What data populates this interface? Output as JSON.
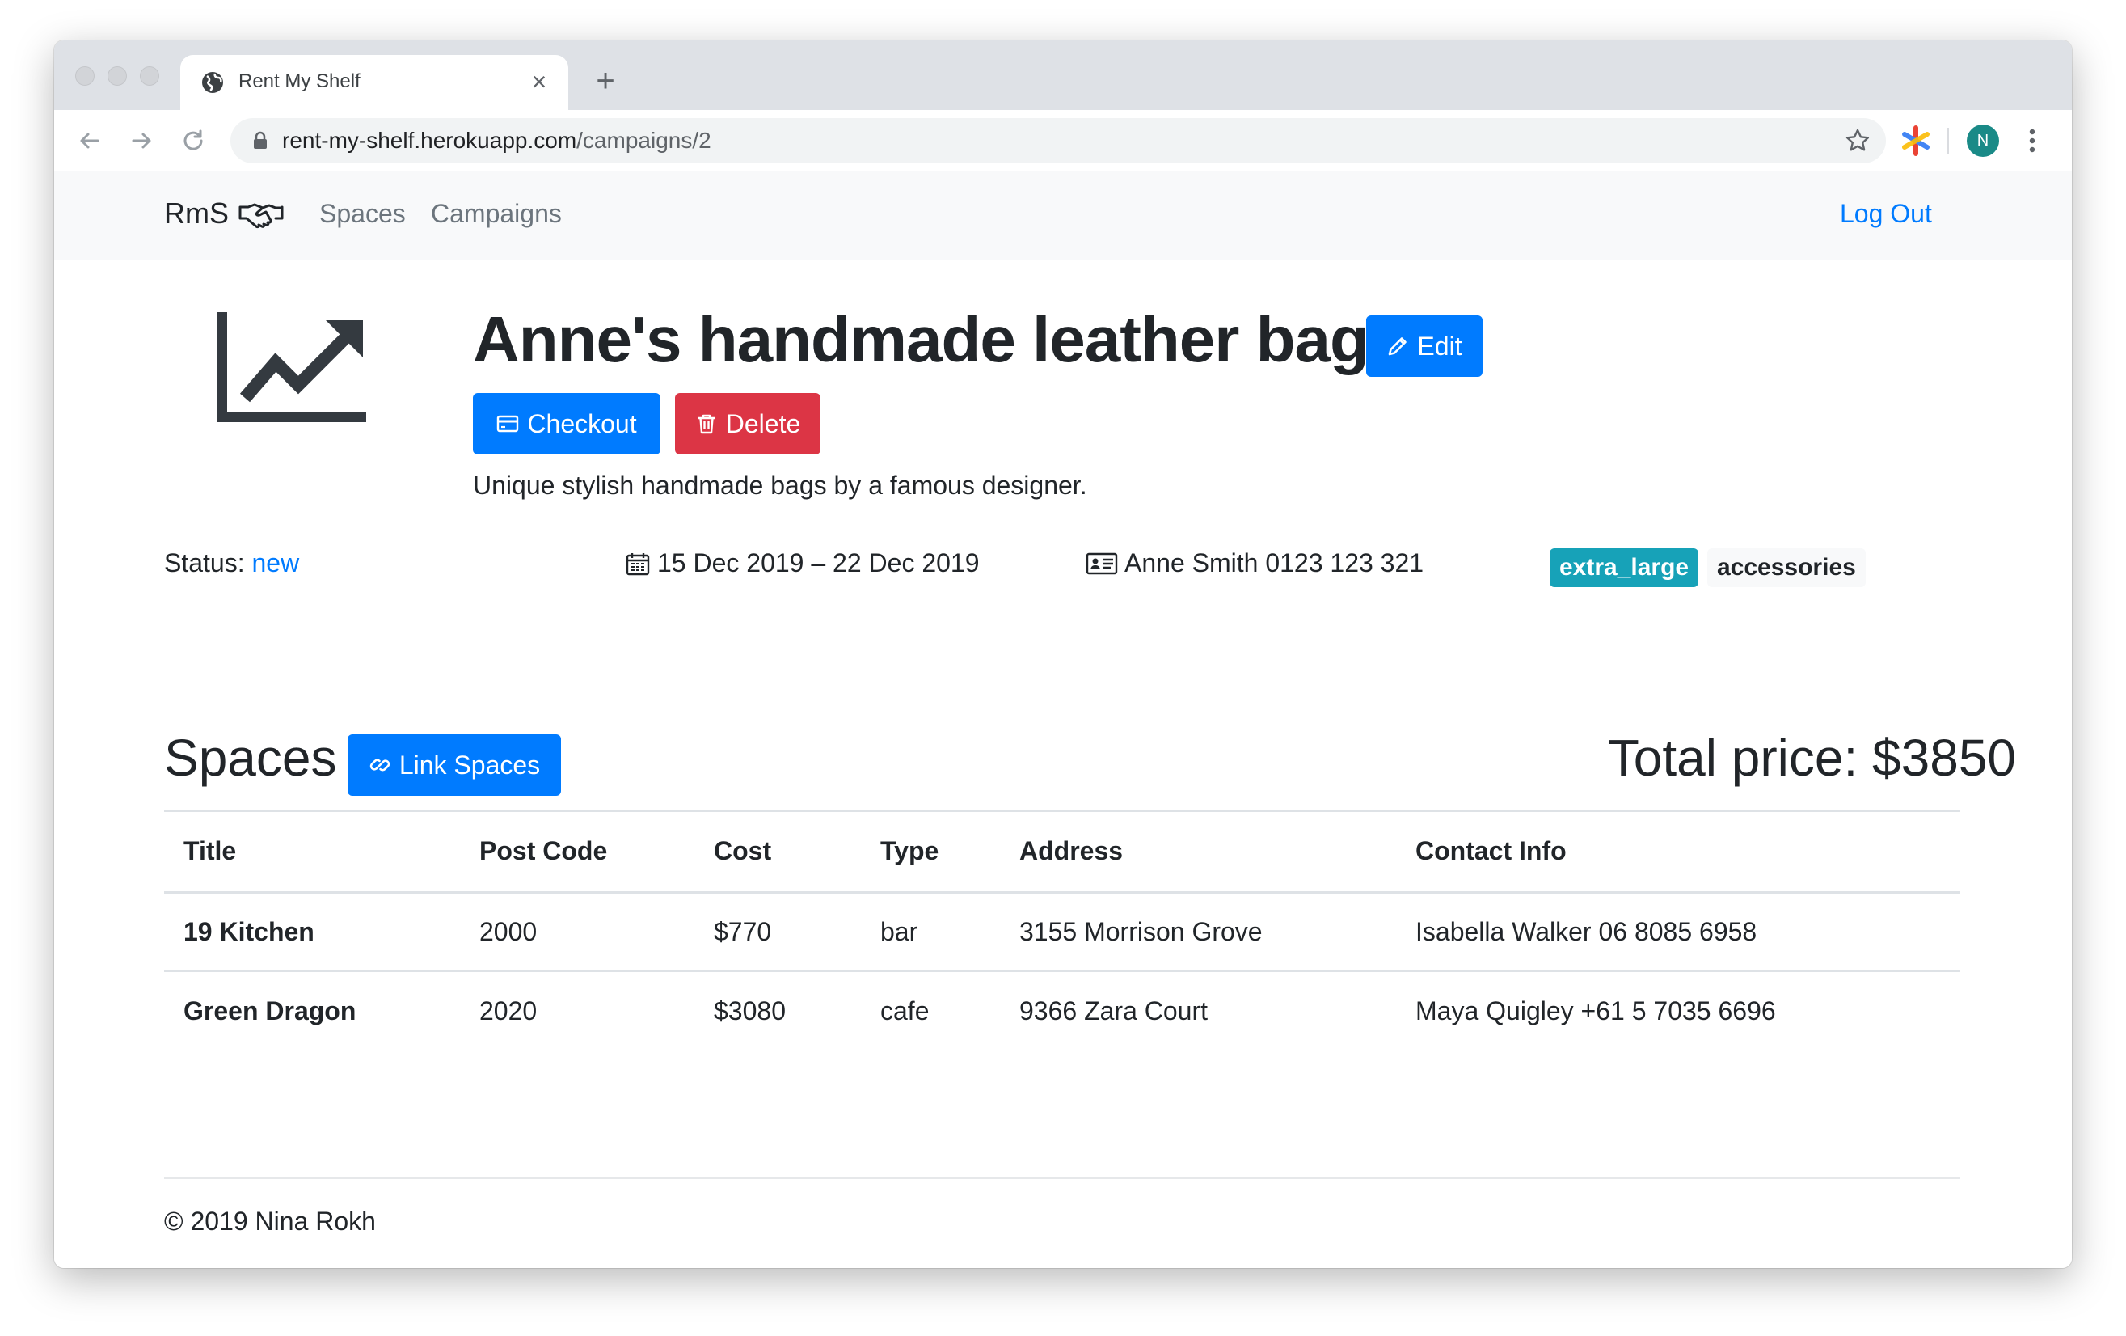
{
  "browser": {
    "tab_title": "Rent My Shelf",
    "close_glyph": "×",
    "new_tab_glyph": "+",
    "url_host": "rent-my-shelf.herokuapp.com",
    "url_path": "/campaigns/2",
    "profile_initial": "N"
  },
  "navbar": {
    "brand": "RmS",
    "brand_icon": "handshake-icon",
    "links": [
      "Spaces",
      "Campaigns"
    ],
    "logout": "Log Out"
  },
  "campaign": {
    "title": "Anne's handmade leather bags",
    "edit_label": "Edit",
    "checkout_label": "Checkout",
    "delete_label": "Delete",
    "description": "Unique stylish handmade bags by a famous designer.",
    "status_label": "Status:",
    "status_value": "new",
    "dates": "15 Dec 2019 – 22 Dec 2019",
    "contact": "Anne Smith 0123 123 321",
    "size_badge": "extra_large",
    "category_badge": "accessories"
  },
  "spaces": {
    "heading": "Spaces",
    "link_label": "Link Spaces",
    "total": "Total price: $3850",
    "columns": [
      "Title",
      "Post Code",
      "Cost",
      "Type",
      "Address",
      "Contact Info"
    ],
    "rows": [
      [
        "19 Kitchen",
        "2000",
        "$770",
        "bar",
        "3155 Morrison Grove",
        "Isabella Walker 06 8085 6958"
      ],
      [
        "Green Dragon",
        "2020",
        "$3080",
        "cafe",
        "9366 Zara Court",
        "Maya Quigley +61 5 7035 6696"
      ]
    ]
  },
  "footer": {
    "text": "© 2019 Nina Rokh"
  },
  "colors": {
    "primary": "#007bff",
    "danger": "#dc3545",
    "info": "#17a2b8",
    "light": "#f8f9fa",
    "text": "#212529",
    "muted": "#6c757d"
  }
}
